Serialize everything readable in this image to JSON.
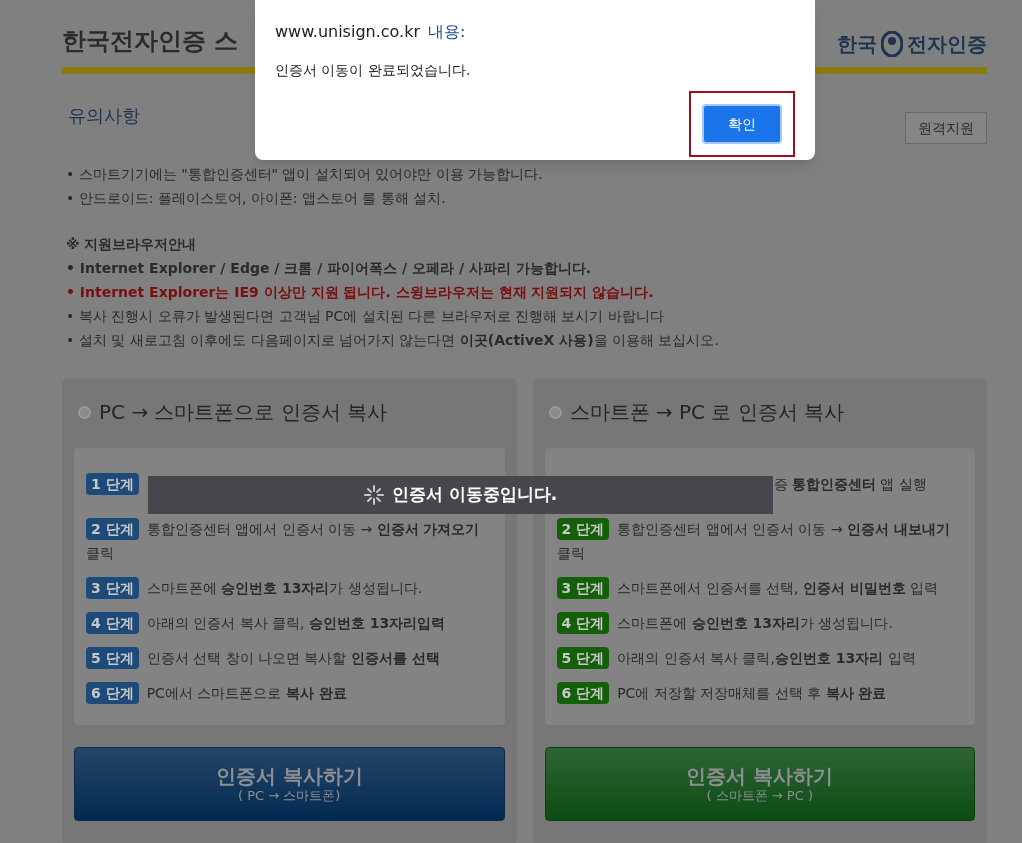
{
  "header": {
    "title": "한국전자인증 스",
    "logo_text": [
      "한국",
      "전자인증"
    ]
  },
  "notice": {
    "title": "유의사항",
    "remote_button": "원격지원",
    "lines": [
      {
        "kind": "normal",
        "text": "• 스마트기기에는 \"통합인증센터\" 앱이 설치되어 있어야만 이용 가능합니다."
      },
      {
        "kind": "normal",
        "text": "• 안드로이드: 플레이스토어, 아이폰: 앱스토어 를 통해 설치."
      },
      {
        "kind": "gap"
      },
      {
        "kind": "heading",
        "text": "※ 지원브라우저안내"
      },
      {
        "kind": "strong",
        "text": "• Internet Explorer / Edge / 크롬 / 파이어폭스 / 오페라 / 사파리 가능합니다."
      },
      {
        "kind": "warning",
        "text": "• Internet Explorer는 IE9 이상만 지원 됩니다. 스윙브라우저는 현재 지원되지 않습니다."
      },
      {
        "kind": "normal",
        "text": "• 복사 진행시 오류가 발생된다면 고객님 PC에 설치된 다른 브라우저로 진행해 보시기 바랍니다"
      },
      {
        "kind": "normal",
        "text": "• 설치 및 새로고침 이후에도 다음페이지로 넘어가지 않는다면 **이곳(ActiveX 사용)**을 이용해 보십시오."
      }
    ]
  },
  "panels": [
    {
      "color": "#1d4a78",
      "title": "PC → 스마트폰으로 인증서 복사",
      "steps": [
        {
          "badge": "1 단계",
          "kind": "empty"
        },
        {
          "badge": "2 단계",
          "text": "통합인증센터 앱에서 인증서 이동 → **인증서 가져오기**",
          "continued": "클릭"
        },
        {
          "badge": "3 단계",
          "text": "스마트폰에 **승인번호 13자리**가 생성됩니다."
        },
        {
          "badge": "4 단계",
          "text": "아래의 인증서 복사 클릭, **승인번호 13자리입력**"
        },
        {
          "badge": "5 단계",
          "text": "인증서 선택 창이 나오면 복사할 **인증서를 선택**"
        },
        {
          "badge": "6 단계",
          "text": "PC에서 스마트폰으로 **복사 완료**"
        }
      ],
      "button": {
        "label": "인증서 복사하기",
        "sub": "( PC → 스마트폰)"
      }
    },
    {
      "color": "#155f0a",
      "title": "스마트폰 → PC 로 인증서 복사",
      "steps": [
        {
          "kind": "partial",
          "text": "증 **통합인증센터** 앱 실행"
        },
        {
          "badge": "2 단계",
          "text": "통합인증센터 앱에서 인증서 이동 → **인증서 내보내기**",
          "continued": "클릭"
        },
        {
          "badge": "3 단계",
          "text": "스마트폰에서 인증서를 선택, **인증서 비밀번호** 입력"
        },
        {
          "badge": "4 단계",
          "text": "스마트폰에 **승인번호 13자리**가 생성됩니다."
        },
        {
          "badge": "5 단계",
          "text": "아래의 인증서 복사 클릭,**승인번호 13자리** 입력"
        },
        {
          "badge": "6 단계",
          "text": "PC에 저장할 저장매체를 선택 후 **복사 완료**"
        }
      ],
      "button": {
        "label": "인증서 복사하기",
        "sub": "( 스마트폰 → PC )"
      }
    }
  ],
  "loading": {
    "text": "인증서 이동중입니다."
  },
  "dialog": {
    "origin": "www.unisign.co.kr",
    "origin_suffix": "내용:",
    "message": "인증서 이동이 완료되었습니다.",
    "ok_button": "확인",
    "highlighted": true
  }
}
